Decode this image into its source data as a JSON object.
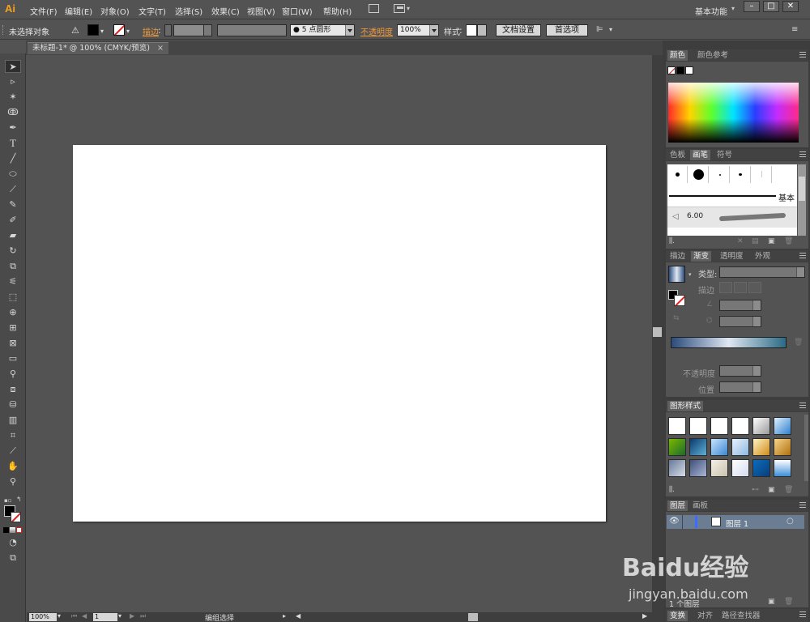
{
  "app": {
    "logo": "Ai",
    "workspace": "基本功能"
  },
  "menu": [
    "文件(F)",
    "编辑(E)",
    "对象(O)",
    "文字(T)",
    "选择(S)",
    "效果(C)",
    "视图(V)",
    "窗口(W)",
    "帮助(H)"
  ],
  "control": {
    "selection": "未选择对象",
    "stroke_label": "描边",
    "brush_size": "5 点圆形",
    "opacity_label": "不透明度",
    "opacity_value": "100%",
    "style_label": "样式",
    "doc_setup": "文档设置",
    "prefs": "首选项"
  },
  "document": {
    "tab": "未标题-1* @ 100% (CMYK/预览)"
  },
  "status": {
    "zoom": "100%",
    "page": "1",
    "selection_mode": "编组选择"
  },
  "panels": {
    "color": {
      "tabs": [
        "颜色",
        "颜色参考"
      ]
    },
    "brushes": {
      "tabs": [
        "色板",
        "画笔",
        "符号"
      ],
      "basic_label": "基本",
      "brush_size": "6.00"
    },
    "gradient": {
      "tabs": [
        "描边",
        "渐变",
        "透明度",
        "外观"
      ],
      "type_label": "类型:",
      "stroke_label": "描边",
      "opacity_label": "不透明度",
      "position_label": "位置"
    },
    "graphic_styles": {
      "tabs": [
        "图形样式"
      ]
    },
    "layers": {
      "tabs": [
        "图层",
        "画板"
      ],
      "layer_name": "图层 1",
      "count_label": "1 个图层"
    },
    "bottom": {
      "tabs": [
        "变换",
        "对齐",
        "路径查找器"
      ]
    }
  },
  "watermark": {
    "brand": "Baidu经验",
    "url": "jingyan.baidu.com"
  },
  "colors": {
    "accent": "#f29a3a",
    "logo": "#f7a21b",
    "artboard": "#ffffff",
    "ui_bg": "#535353"
  }
}
